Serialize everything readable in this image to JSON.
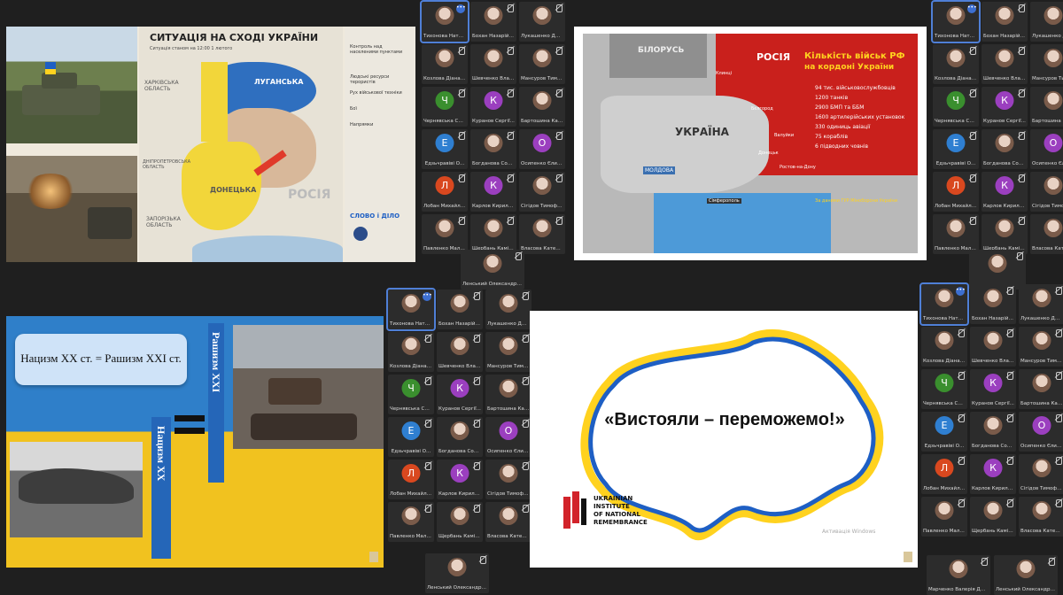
{
  "participants": [
    {
      "name": "Тихонова Наталі...",
      "initial": "",
      "color": "",
      "photo": true
    },
    {
      "name": "Бохан Назарій А...",
      "initial": "",
      "color": "",
      "photo": true
    },
    {
      "name": "Лукашенко Дми...",
      "initial": "",
      "color": "",
      "photo": true
    },
    {
      "name": "Козлова Діана О...",
      "initial": "",
      "color": "",
      "photo": true
    },
    {
      "name": "Шевченко Влад...",
      "initial": "",
      "color": "",
      "photo": true
    },
    {
      "name": "Мансуров Тиму...",
      "initial": "",
      "color": "",
      "photo": true
    },
    {
      "name": "Чернявська Соф...",
      "initial": "Ч",
      "color": "#3a8f2e",
      "photo": false
    },
    {
      "name": "Куранов Сергії...",
      "initial": "К",
      "color": "#9b3fbf",
      "photo": false
    },
    {
      "name": "Бартошина Кате...",
      "initial": "",
      "color": "",
      "photo": true
    },
    {
      "name": "Едзьчравіві О...",
      "initial": "Е",
      "color": "#2f7fd1",
      "photo": false
    },
    {
      "name": "Богданова Софія",
      "initial": "",
      "color": "",
      "photo": true
    },
    {
      "name": "Осипенко Єлиза...",
      "initial": "О",
      "color": "#9b3fbf",
      "photo": false
    },
    {
      "name": "Лобан Михайло...",
      "initial": "Л",
      "color": "#d9481f",
      "photo": false
    },
    {
      "name": "Карлов Кирило ...",
      "initial": "К",
      "color": "#9b3fbf",
      "photo": false
    },
    {
      "name": "Сігідов Тимофії...",
      "initial": "",
      "color": "",
      "photo": true
    },
    {
      "name": "Павленко Малія...",
      "initial": "",
      "color": "",
      "photo": true
    },
    {
      "name": "Щербань Каміла...",
      "initial": "",
      "color": "",
      "photo": true
    },
    {
      "name": "Власова Катери...",
      "initial": "",
      "color": "",
      "photo": true
    }
  ],
  "extra_participant": {
    "name": "Ленський Олександр Ром..."
  },
  "extra_participants_br": [
    {
      "name": "Марченко Валерія Дмитр..."
    },
    {
      "name": "Ленський Олександр Ром..."
    }
  ],
  "slide1": {
    "title": "СИТУАЦІЯ НА СХОДІ УКРАЇНИ",
    "subtitle": "Ситуація станом на 12:00 1 лютого",
    "regions": [
      "ХАРКІВСЬКА ОБЛАСТЬ",
      "ЛУГАНСЬКА",
      "ДОНЕЦЬКА",
      "ДНІПРОПЕТРОВСЬКА ОБЛАСТЬ",
      "ЗАПОРІЗЬКА ОБЛАСТЬ",
      "РОСІЯ"
    ],
    "legend_title": "Контроль над населеними пунктами",
    "legend_items": [
      "Людські ресурси терористів",
      "Рух військової техніки",
      "Бої",
      "Напрямки"
    ],
    "logo_text": "СЛОВО і ДІЛО"
  },
  "slide2": {
    "title_line1": "Кількість військ РФ",
    "title_line2": "на кордоні України",
    "stats": [
      "94 тис. військовослужбовців",
      "1200 танків",
      "2900 БМП та ББМ",
      "1600 артилерійських установок",
      "330 одиниць авіації",
      "75 кораблів",
      "6 підводних човнів"
    ],
    "source": "За даними ГУР Міноборони України",
    "countries": {
      "belarus": "БІЛОРУСЬ",
      "russia": "РОСІЯ",
      "ukraine": "УКРАЇНА",
      "moldova": "МОЛДОВА"
    },
    "cities": [
      "Клинці",
      "Бєлгород",
      "Валуйки",
      "Донецьк",
      "Ростов-на-Дону",
      "Сімферополь"
    ]
  },
  "slide3": {
    "equation": "Нацизм ХХ ст. = Рашизм ХХІ ст.",
    "vertical_right": "Рашизм ХХІ",
    "vertical_left": "Нацизм ХХ"
  },
  "slide4": {
    "slogan": "«Вистояли – переможемо!»",
    "institute": [
      "UKRAINIAN",
      "INSTITUTE",
      "OF NATIONAL",
      "REMEMBRANCE"
    ],
    "watermark": "Активація Windows"
  },
  "colors": {
    "ua_blue": "#1e5fc4",
    "ua_yellow": "#ffd21f",
    "russia_red": "#c9201c"
  }
}
